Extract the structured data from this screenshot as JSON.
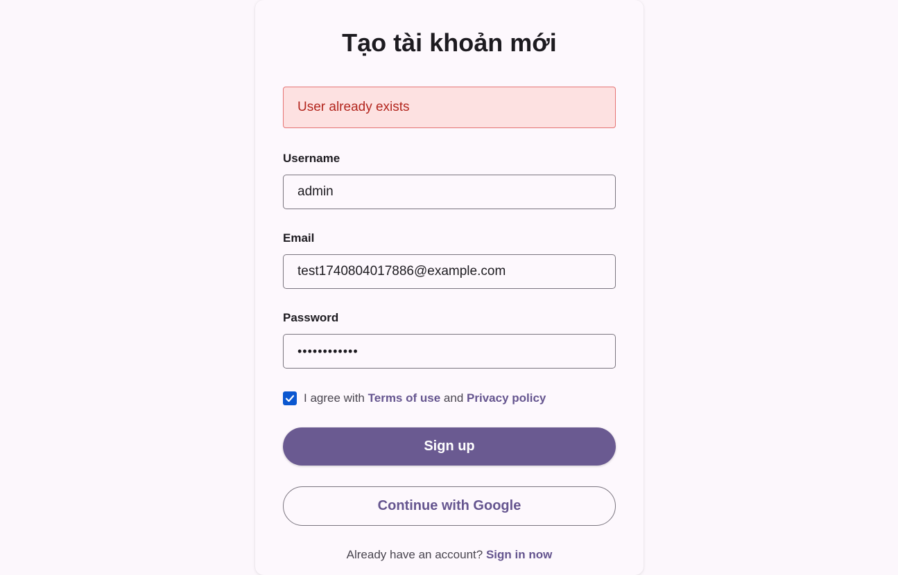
{
  "form": {
    "title": "Tạo tài khoản mới",
    "error_message": "User already exists",
    "username_label": "Username",
    "username_value": "admin",
    "email_label": "Email",
    "email_value": "test1740804017886@example.com",
    "password_label": "Password",
    "password_value": "••••••••••••",
    "agree_checked": true,
    "agree_prefix": "I agree with",
    "terms_link": "Terms of use",
    "agree_and": "and",
    "privacy_link": "Privacy policy",
    "signup_label": "Sign up",
    "google_label": "Continue with Google",
    "signin_prompt": "Already have an account?",
    "signin_link": "Sign in now"
  },
  "colors": {
    "background": "#fcf7fc",
    "primary": "#6a5a91",
    "link": "#65558f",
    "error_text": "#b3261e",
    "error_background": "#fde1e1",
    "checkbox": "#0b57d0"
  },
  "icons": {
    "checkbox": "check-icon"
  }
}
